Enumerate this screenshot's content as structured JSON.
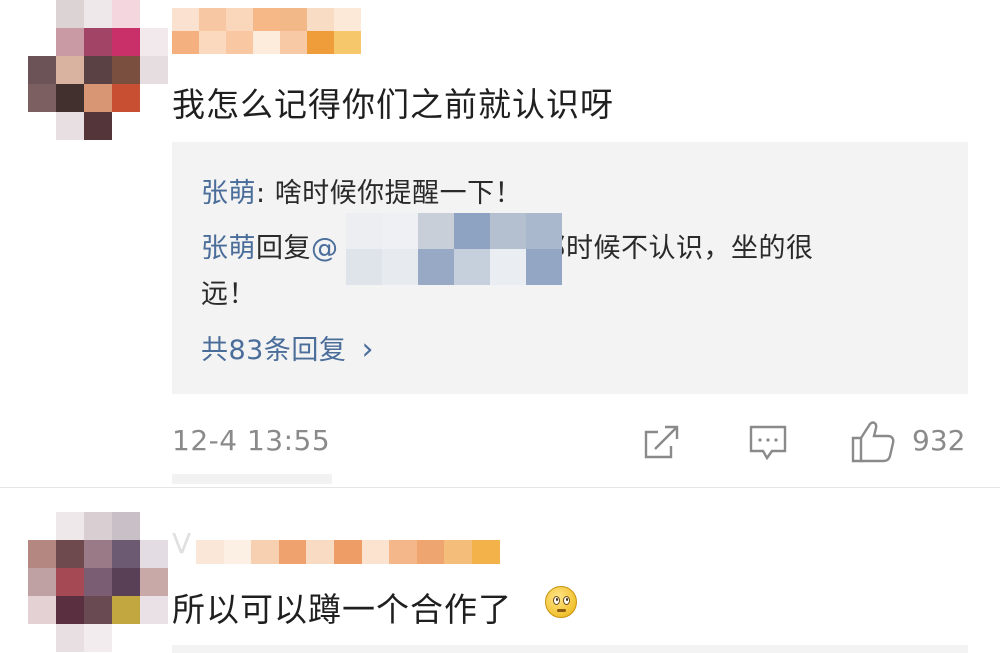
{
  "comment1": {
    "text": "我怎么记得你们之前就认识呀",
    "replies": [
      {
        "author": "张萌",
        "sep": ": ",
        "text": "啥时候你提醒一下！"
      },
      {
        "author": "张萌",
        "verb": "回复",
        "mention": "@",
        "text_line1": "那时候不认识，坐的很",
        "text_line2": "远！"
      }
    ],
    "more_replies": "共83条回复",
    "more_chevron": "›",
    "timestamp": "12-4 13:55",
    "like_count": "932"
  },
  "comment2": {
    "text": "所以可以蹲一个合作了",
    "emoji": "thinking-eyes-emoji",
    "username_fragment": "V"
  },
  "colors": {
    "reply_author": "#4a6d9a",
    "reply_bg": "#f3f3f3",
    "meta_text": "#8a8a8a"
  },
  "icons": [
    "share-icon",
    "comment-icon",
    "like-icon",
    "chevron-right-icon"
  ]
}
